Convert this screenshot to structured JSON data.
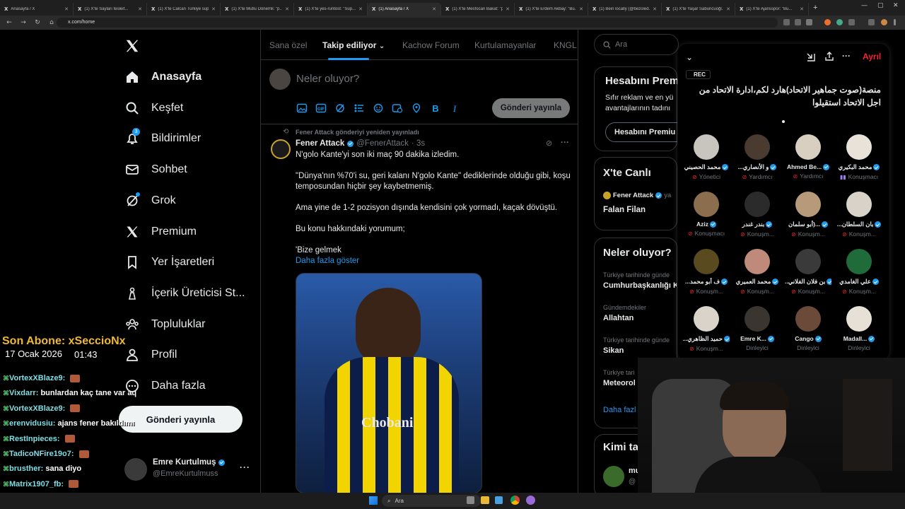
{
  "browser": {
    "tabs": [
      {
        "label": "Anasayfa / X",
        "active": false
      },
      {
        "label": "(1) X'te Sayları tesleif...",
        "active": false
      },
      {
        "label": "(1) X'te Calcan Türkiye sup...",
        "active": false
      },
      {
        "label": "(1) X'te Mutlu Dönemli: \"p...",
        "active": false
      },
      {
        "label": "(1) X'te yes-runtost: \"Süp...",
        "active": false
      },
      {
        "label": "(1) Anasayfa / X",
        "active": true
      },
      {
        "label": "(1) X'te Mesfocan Bakat: \"p...",
        "active": false
      },
      {
        "label": "(1) X'te Erdem Akbay: \"Bu...",
        "active": false
      },
      {
        "label": "(1) Bein locally (@bezoled...",
        "active": false
      },
      {
        "label": "(1) X'te Yaşar Sabuncuoğl...",
        "active": false
      },
      {
        "label": "(1) X'te Ajansspor: \"Bu...",
        "active": false
      }
    ],
    "url": "x.com/home"
  },
  "nav": {
    "items": [
      {
        "label": "Anasayfa",
        "icon": "home-icon"
      },
      {
        "label": "Keşfet",
        "icon": "search-icon"
      },
      {
        "label": "Bildirimler",
        "icon": "bell-icon",
        "badge": "3"
      },
      {
        "label": "Sohbet",
        "icon": "mail-icon"
      },
      {
        "label": "Grok",
        "icon": "grok-icon"
      },
      {
        "label": "Premium",
        "icon": "x-icon"
      },
      {
        "label": "Yer İşaretleri",
        "icon": "bookmark-icon"
      },
      {
        "label": "İçerik Üreticisi St...",
        "icon": "creator-icon"
      },
      {
        "label": "Topluluklar",
        "icon": "communities-icon"
      },
      {
        "label": "Profil",
        "icon": "profile-icon"
      },
      {
        "label": "Daha fazla",
        "icon": "more-icon"
      }
    ],
    "post_button": "Gönderi yayınla",
    "account": {
      "name": "Emre Kurtulmuş",
      "handle": "@EmreKurtulmuss"
    }
  },
  "feed": {
    "tabs": [
      "Sana özel",
      "Takip ediliyor",
      "Kachow Forum",
      "Kurtulamayanlar",
      "KNGL"
    ],
    "compose_placeholder": "Neler oluyor?",
    "compose_button": "Gönderi yayınla",
    "tweet": {
      "repost_label": "Fener Attack gönderiyi yeniden yayınladı",
      "author": "Fener Attack",
      "handle": "@FenerAttack",
      "time": "· 3s",
      "lines": [
        "N'golo Kante'yi son iki maç 90 dakika izledim.",
        "\"Dünya'nın %70'i su, geri kalanı N'golo Kante\" dediklerinde olduğu gibi, koşu temposundan hiçbir şey kaybetmemiş.",
        "Ama yine de 1-2 pozisyon dışında kendisini çok yormadı, kaçak dövüştü.",
        "Bu konu hakkındaki yorumum;",
        "'Bize gelmek"
      ],
      "show_more": "Daha fazla göster",
      "image_text": "Chobani"
    }
  },
  "right": {
    "search_placeholder": "Ara",
    "premium": {
      "title": "Hesabını Prem",
      "body": "Sıfır reklam ve en yü avantajlarının tadını",
      "button": "Hesabını Premiu"
    },
    "live": {
      "title": "X'te Canlı",
      "host": "Fener Attack",
      "host_suffix": "ya",
      "topic": "Falan Filan"
    },
    "trends": {
      "title": "Neler oluyor?",
      "items": [
        {
          "meta": "Türkiye tarihinde günde",
          "name": "Cumhurbaşkanlığı K"
        },
        {
          "meta": "Gündemdekiler",
          "name": "Allahtan"
        },
        {
          "meta": "Türkiye tarihinde günde",
          "name": "Sikan"
        },
        {
          "meta": "Türkiye tari",
          "name": "Meteorol"
        }
      ],
      "show_more": "Daha fazl"
    },
    "who_follow": {
      "title": "Kimi ta",
      "name": "mu",
      "handle": "@"
    }
  },
  "space": {
    "leave": "Ayrıl",
    "rec": "REC",
    "title": "منصة(صوت جماهير الاتحاد)هارد لكم،ادارة الاتحاد من اجل الاتحاد استقيلوا",
    "speakers": [
      {
        "name": "محمد الحصيني",
        "role": "Yönetici",
        "color": "#c8c4be"
      },
      {
        "name": "...و الأنصاري",
        "role": "Yardımcı",
        "color": "#4a3a30"
      },
      {
        "name": "Ahmed Be...",
        "role": "Yardımcı",
        "color": "#d9cfc0"
      },
      {
        "name": "محمد البكيري",
        "role": "Konuşmacı",
        "color": "#e8e2d8"
      },
      {
        "name": "Aziz",
        "role": "Konuşmacı",
        "color": "#8a6e4e"
      },
      {
        "name": "بندر غندر",
        "role": "Konuşm...",
        "color": "#2b2b2b"
      },
      {
        "name": "أبو سلمان)...",
        "role": "Konuşm...",
        "color": "#b79a7a"
      },
      {
        "name": "...بان السلطان",
        "role": "Konuşm...",
        "color": "#d8d2c8"
      },
      {
        "name": "...ف أبو محمد",
        "role": "Konuşm...",
        "color": "#5a4a20"
      },
      {
        "name": "محمد العميري",
        "role": "Konuşm...",
        "color": "#c08a7a"
      },
      {
        "name": "...بن فلان الفلاني",
        "role": "Konuşm...",
        "color": "#3a3a3a"
      },
      {
        "name": "علي الغامدي",
        "role": "Konuşm...",
        "color": "#1f6b3a"
      },
      {
        "name": "...حميد الظاهري",
        "role": "Konuşm...",
        "color": "#d9d3c9"
      },
      {
        "name": "Emre K...",
        "role": "Dinleyici",
        "color": "#3b3530"
      },
      {
        "name": "Cango",
        "role": "Dinleyici",
        "color": "#6b4a3a"
      },
      {
        "name": "Madall...",
        "role": "Dinleyici",
        "color": "#e6e0d6"
      }
    ]
  },
  "stream": {
    "subscriber": "Son Abone: xSeccioNx",
    "date": "17 Ocak 2026",
    "time": "01:43",
    "chat": [
      {
        "user": "VortexXBlaze9:",
        "msg": "",
        "emote": true
      },
      {
        "user": "Vixdarr:",
        "msg": "bunlardan kaç tane var aq",
        "emote": false
      },
      {
        "user": "VortexXBlaze9:",
        "msg": "",
        "emote": true
      },
      {
        "user": "erenvidusiu:",
        "msg": "ajans fener bakıldımı",
        "emote": false
      },
      {
        "user": "RestInpieces:",
        "msg": "",
        "emote": true
      },
      {
        "user": "TadicoNFire19o7:",
        "msg": "",
        "emote": true
      },
      {
        "user": "brusther:",
        "msg": "sana diyo",
        "emote": false
      },
      {
        "user": "Matrix1907_fb:",
        "msg": "",
        "emote": true
      },
      {
        "user": "Matrix1907_fb:",
        "msg": "",
        "emote": true
      }
    ]
  },
  "taskbar": {
    "search": "Ara"
  }
}
